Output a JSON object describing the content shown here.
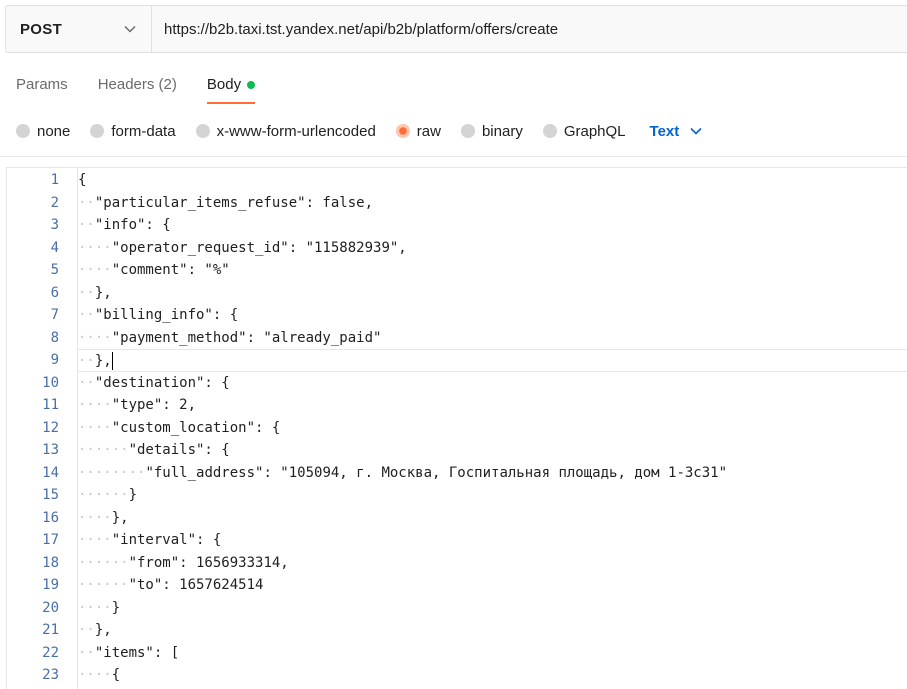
{
  "request": {
    "method": "POST",
    "url": "https://b2b.taxi.tst.yandex.net/api/b2b/platform/offers/create"
  },
  "tabs": [
    {
      "label": "Params",
      "active": false
    },
    {
      "label": "Headers (2)",
      "active": false
    },
    {
      "label": "Body",
      "active": true
    }
  ],
  "body_types": [
    {
      "label": "none",
      "selected": false
    },
    {
      "label": "form-data",
      "selected": false
    },
    {
      "label": "x-www-form-urlencoded",
      "selected": false
    },
    {
      "label": "raw",
      "selected": true
    },
    {
      "label": "binary",
      "selected": false
    },
    {
      "label": "GraphQL",
      "selected": false
    }
  ],
  "raw_format": "Text",
  "colors": {
    "accent": "#ff6c37",
    "link": "#0265d2",
    "status_dot": "#0cbb52"
  },
  "editor": {
    "lines": [
      {
        "n": "1",
        "indent": 0,
        "text": "{"
      },
      {
        "n": "2",
        "indent": 1,
        "text": "\"particular_items_refuse\": false,"
      },
      {
        "n": "3",
        "indent": 1,
        "text": "\"info\": {"
      },
      {
        "n": "4",
        "indent": 2,
        "text": "\"operator_request_id\": \"115882939\","
      },
      {
        "n": "5",
        "indent": 2,
        "text": "\"comment\": \"%\""
      },
      {
        "n": "6",
        "indent": 1,
        "text": "},"
      },
      {
        "n": "7",
        "indent": 1,
        "text": "\"billing_info\": {"
      },
      {
        "n": "8",
        "indent": 2,
        "text": "\"payment_method\": \"already_paid\""
      },
      {
        "n": "9",
        "indent": 1,
        "text": "},",
        "cursor": true
      },
      {
        "n": "10",
        "indent": 1,
        "text": "\"destination\": {"
      },
      {
        "n": "11",
        "indent": 2,
        "text": "\"type\": 2,"
      },
      {
        "n": "12",
        "indent": 2,
        "text": "\"custom_location\": {"
      },
      {
        "n": "13",
        "indent": 3,
        "text": "\"details\": {"
      },
      {
        "n": "14",
        "indent": 4,
        "text": "\"full_address\": \"105094, г. Москва, Госпитальная площадь, дом 1-3с31\""
      },
      {
        "n": "15",
        "indent": 3,
        "text": "}"
      },
      {
        "n": "16",
        "indent": 2,
        "text": "},"
      },
      {
        "n": "17",
        "indent": 2,
        "text": "\"interval\": {"
      },
      {
        "n": "18",
        "indent": 3,
        "text": "\"from\": 1656933314,"
      },
      {
        "n": "19",
        "indent": 3,
        "text": "\"to\": 1657624514"
      },
      {
        "n": "20",
        "indent": 2,
        "text": "}"
      },
      {
        "n": "21",
        "indent": 1,
        "text": "},"
      },
      {
        "n": "22",
        "indent": 1,
        "text": "\"items\": ["
      },
      {
        "n": "23",
        "indent": 2,
        "text": "{"
      }
    ]
  }
}
